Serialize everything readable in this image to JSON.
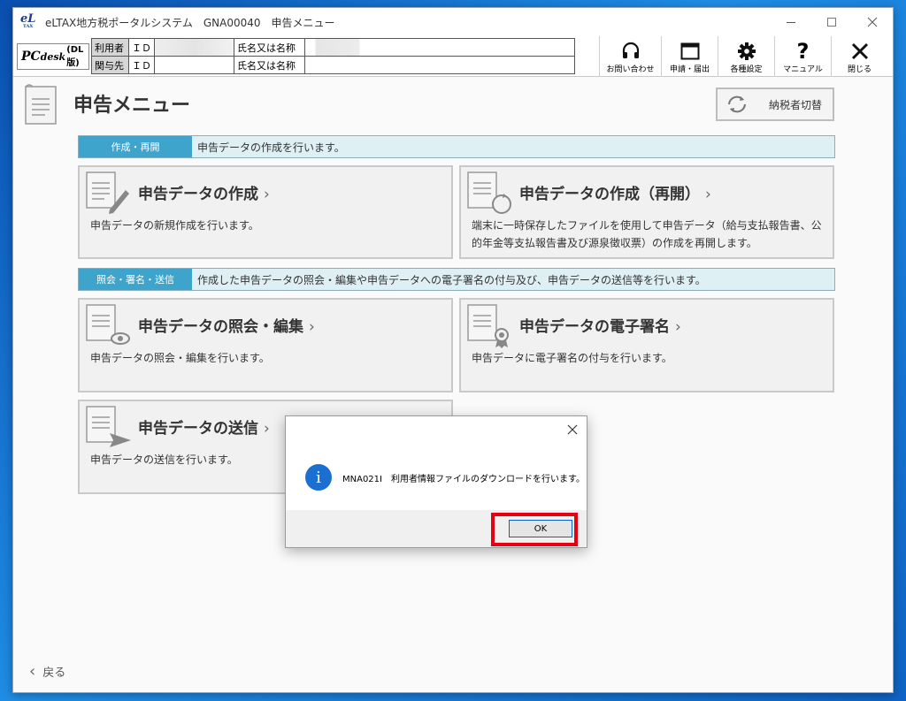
{
  "window": {
    "title": "eLTAX地方税ポータルシステム　GNA00040　申告メニュー",
    "logo_text": "eL",
    "logo_sub": "TAX"
  },
  "header": {
    "pc_logo": "PC",
    "pc_logo_rest": "desk",
    "pc_logo_small": "(DL版)",
    "rows": [
      {
        "label": "利用者",
        "id_label": "ＩＤ",
        "id_value": "",
        "name_label": "氏名又は名称",
        "name_value": ""
      },
      {
        "label": "関与先",
        "id_label": "ＩＤ",
        "id_value": "",
        "name_label": "氏名又は名称",
        "name_value": ""
      }
    ],
    "toolbar": [
      {
        "label": "お問い合わせ",
        "icon": "headset-icon"
      },
      {
        "label": "申請・届出",
        "icon": "window-icon"
      },
      {
        "label": "各種設定",
        "icon": "gear-icon"
      },
      {
        "label": "マニュアル",
        "icon": "question-icon"
      },
      {
        "label": "閉じる",
        "icon": "close-icon"
      }
    ]
  },
  "page": {
    "title": "申告メニュー",
    "switch_label": "納税者切替",
    "back_label": "戻る"
  },
  "sections": [
    {
      "tag": "作成・再開",
      "text": "申告データの作成を行います。"
    },
    {
      "tag": "照会・署名・送信",
      "text": "作成した申告データの照会・編集や申告データへの電子署名の付与及び、申告データの送信等を行います。"
    }
  ],
  "cards": [
    {
      "title": "申告データの作成",
      "desc": "申告データの新規作成を行います。",
      "icon": "document-pencil-icon"
    },
    {
      "title": "申告データの作成（再開）",
      "desc": "端末に一時保存したファイルを使用して申告データ（給与支払報告書、公的年金等支払報告書及び源泉徴収票）の作成を再開します。",
      "icon": "document-refresh-icon"
    },
    {
      "title": "申告データの照会・編集",
      "desc": "申告データの照会・編集を行います。",
      "icon": "document-view-icon"
    },
    {
      "title": "申告データの電子署名",
      "desc": "申告データに電子署名の付与を行います。",
      "icon": "document-seal-icon"
    },
    {
      "title": "申告データの送信",
      "desc": "申告データの送信を行います。",
      "icon": "document-send-icon"
    }
  ],
  "dialog": {
    "message": "MNA021I　利用者情報ファイルのダウンロードを行います。",
    "ok_label": "OK"
  },
  "colors": {
    "section_tag": "#3fa4cc",
    "section_bg": "#dff0f5",
    "highlight": "#e60012",
    "info_icon": "#1a6fd0"
  }
}
